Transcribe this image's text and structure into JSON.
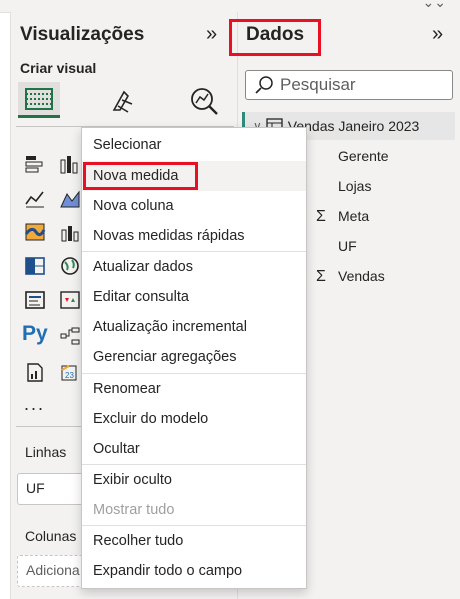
{
  "topbar": {
    "expand_icon": "double-chevron-down-icon"
  },
  "visualizations": {
    "title": "Visualizações",
    "collapse_icon": "double-chevron-right-icon",
    "build_label": "Criar visual",
    "build_tabs": [
      "build-visual-icon",
      "format-visual-icon",
      "analytics-icon"
    ],
    "more": "...",
    "wells": {
      "rows_label": "Linhas",
      "rows_value": "UF",
      "columns_label": "Colunas",
      "columns_placeholder": "Adiciona"
    }
  },
  "data_pane": {
    "title": "Dados",
    "collapse_icon": "double-chevron-right-icon",
    "search_placeholder": "Pesquisar",
    "table": {
      "name": "Vendas Janeiro 2023",
      "fields": [
        {
          "name": "Gerente",
          "sigma": ""
        },
        {
          "name": "Lojas",
          "sigma": ""
        },
        {
          "name": "Meta",
          "sigma": "Σ"
        },
        {
          "name": "UF",
          "sigma": ""
        },
        {
          "name": "Vendas",
          "sigma": "Σ"
        }
      ]
    }
  },
  "context_menu": {
    "items": [
      "Selecionar",
      "Nova medida",
      "Nova coluna",
      "Novas medidas rápidas",
      "Atualizar dados",
      "Editar consulta",
      "Atualização incremental",
      "Gerenciar agregações",
      "Renomear",
      "Excluir do modelo",
      "Ocultar",
      "Exibir oculto",
      "Mostrar tudo",
      "Recolher tudo",
      "Expandir todo o campo"
    ],
    "highlighted": "Nova medida",
    "disabled": "Mostrar tudo"
  },
  "colors": {
    "highlight": "#e81123",
    "table_accent": "#2e8b7a",
    "viz_selected": "#217346"
  }
}
